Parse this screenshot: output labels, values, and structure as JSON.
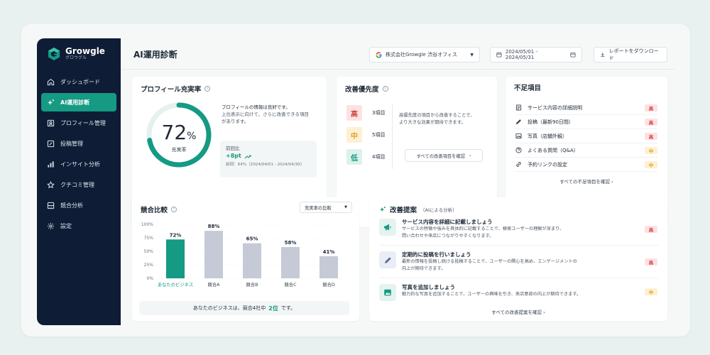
{
  "app": {
    "name": "Growgle",
    "subname": "グロウグル",
    "accent": "#159a84",
    "sidebar_bg": "#0e1d35"
  },
  "nav": [
    {
      "label": "ダッシュボード",
      "icon": "home-icon"
    },
    {
      "label": "AI運用診断",
      "icon": "ai-sparkle-icon",
      "active": true
    },
    {
      "label": "プロフィール管理",
      "icon": "profile-icon"
    },
    {
      "label": "投稿管理",
      "icon": "edit-post-icon"
    },
    {
      "label": "インサイト分析",
      "icon": "bar-chart-icon"
    },
    {
      "label": "クチコミ管理",
      "icon": "star-icon"
    },
    {
      "label": "競合分析",
      "icon": "compare-icon"
    },
    {
      "label": "設定",
      "icon": "gear-icon"
    }
  ],
  "header": {
    "title": "AI運用診断",
    "store": "株式会社Growgle 渋谷オフィス",
    "date_range": "2024/05/01 - 2024/05/31",
    "download_label": "レポートをダウンロード"
  },
  "profile": {
    "title": "プロフィール充実率",
    "rate": 72,
    "rate_text": "72",
    "percent_sign": "%",
    "rate_label": "充実率",
    "message1": "プロフィールの情報は良好です。",
    "message2": "上位表示に向けて、さらに改善できる項目",
    "message3": "があります。",
    "compare_label": "前回比",
    "compare_value": "+8pt",
    "compare_prev": "前回：64%（2024/04/01 - 2024/04/30）"
  },
  "priority": {
    "title": "改善優先度",
    "items": [
      {
        "tag": "高",
        "count": "3項目",
        "level": "high"
      },
      {
        "tag": "中",
        "count": "5項目",
        "level": "mid"
      },
      {
        "tag": "低",
        "count": "4項目",
        "level": "low"
      }
    ],
    "desc1": "高優先度の項目から改善することで、",
    "desc2": "より大きな効果が期待できます。",
    "link": "すべての改善項目を確認"
  },
  "missing": {
    "title": "不足項目",
    "items": [
      {
        "label": "サービス内容の詳細説明",
        "tag": "高",
        "level": "high",
        "icon": "document-icon"
      },
      {
        "label": "投稿（最新90日間）",
        "tag": "高",
        "level": "high",
        "icon": "pen-icon"
      },
      {
        "label": "写真（店舗外観）",
        "tag": "高",
        "level": "high",
        "icon": "image-icon"
      },
      {
        "label": "よくある質問（Q&A）",
        "tag": "中",
        "level": "mid",
        "icon": "question-icon"
      },
      {
        "label": "予約リンクの設定",
        "tag": "中",
        "level": "mid",
        "icon": "link-icon"
      }
    ],
    "link": "すべての不足項目を確認"
  },
  "competitor": {
    "title": "競合比較",
    "select": "充実率の比較",
    "summary_pre": "あなたのビジネスは、競合4社中",
    "summary_rank": "2位",
    "summary_post": "です。"
  },
  "chart_data": {
    "type": "bar",
    "categories": [
      "あなたのビジネス",
      "競合A",
      "競合B",
      "競合C",
      "競合D"
    ],
    "values": [
      72,
      88,
      65,
      58,
      41
    ],
    "value_labels": [
      "72%",
      "88%",
      "65%",
      "58%",
      "41%"
    ],
    "yticks": [
      "100%",
      "75%",
      "50%",
      "25%",
      "0%"
    ],
    "ylim": [
      0,
      100
    ],
    "colors": [
      "#159a84",
      "#c5cad6",
      "#c5cad6",
      "#c5cad6",
      "#c5cad6"
    ],
    "grid": true
  },
  "suggest": {
    "title": "改善提案",
    "subtitle": "（AIによる分析）",
    "items": [
      {
        "title": "サービス内容を詳細に記載しましょう",
        "desc1": "サービスの特徴や強みを具体的に記載することで、検索ユーザーの理解が深まり、",
        "desc2": "問い合わせや来店につながりやすくなります。",
        "tag": "高",
        "level": "high",
        "icon": "megaphone-icon"
      },
      {
        "title": "定期的に投稿を行いましょう",
        "desc1": "最新の情報を投稿し続ける投稿することで、ユーザーの関心を高め、エンゲージメントの",
        "desc2": "向上が期待できます。",
        "tag": "高",
        "level": "high",
        "icon": "pen-icon"
      },
      {
        "title": "写真を追加しましょう",
        "desc1": "魅力的な写真を追加することで、ユーザーの興味を引き、来店意欲の向上が期待できます。",
        "desc2": "",
        "tag": "中",
        "level": "mid",
        "icon": "image-icon"
      }
    ],
    "link": "すべての改善提案を確認"
  }
}
